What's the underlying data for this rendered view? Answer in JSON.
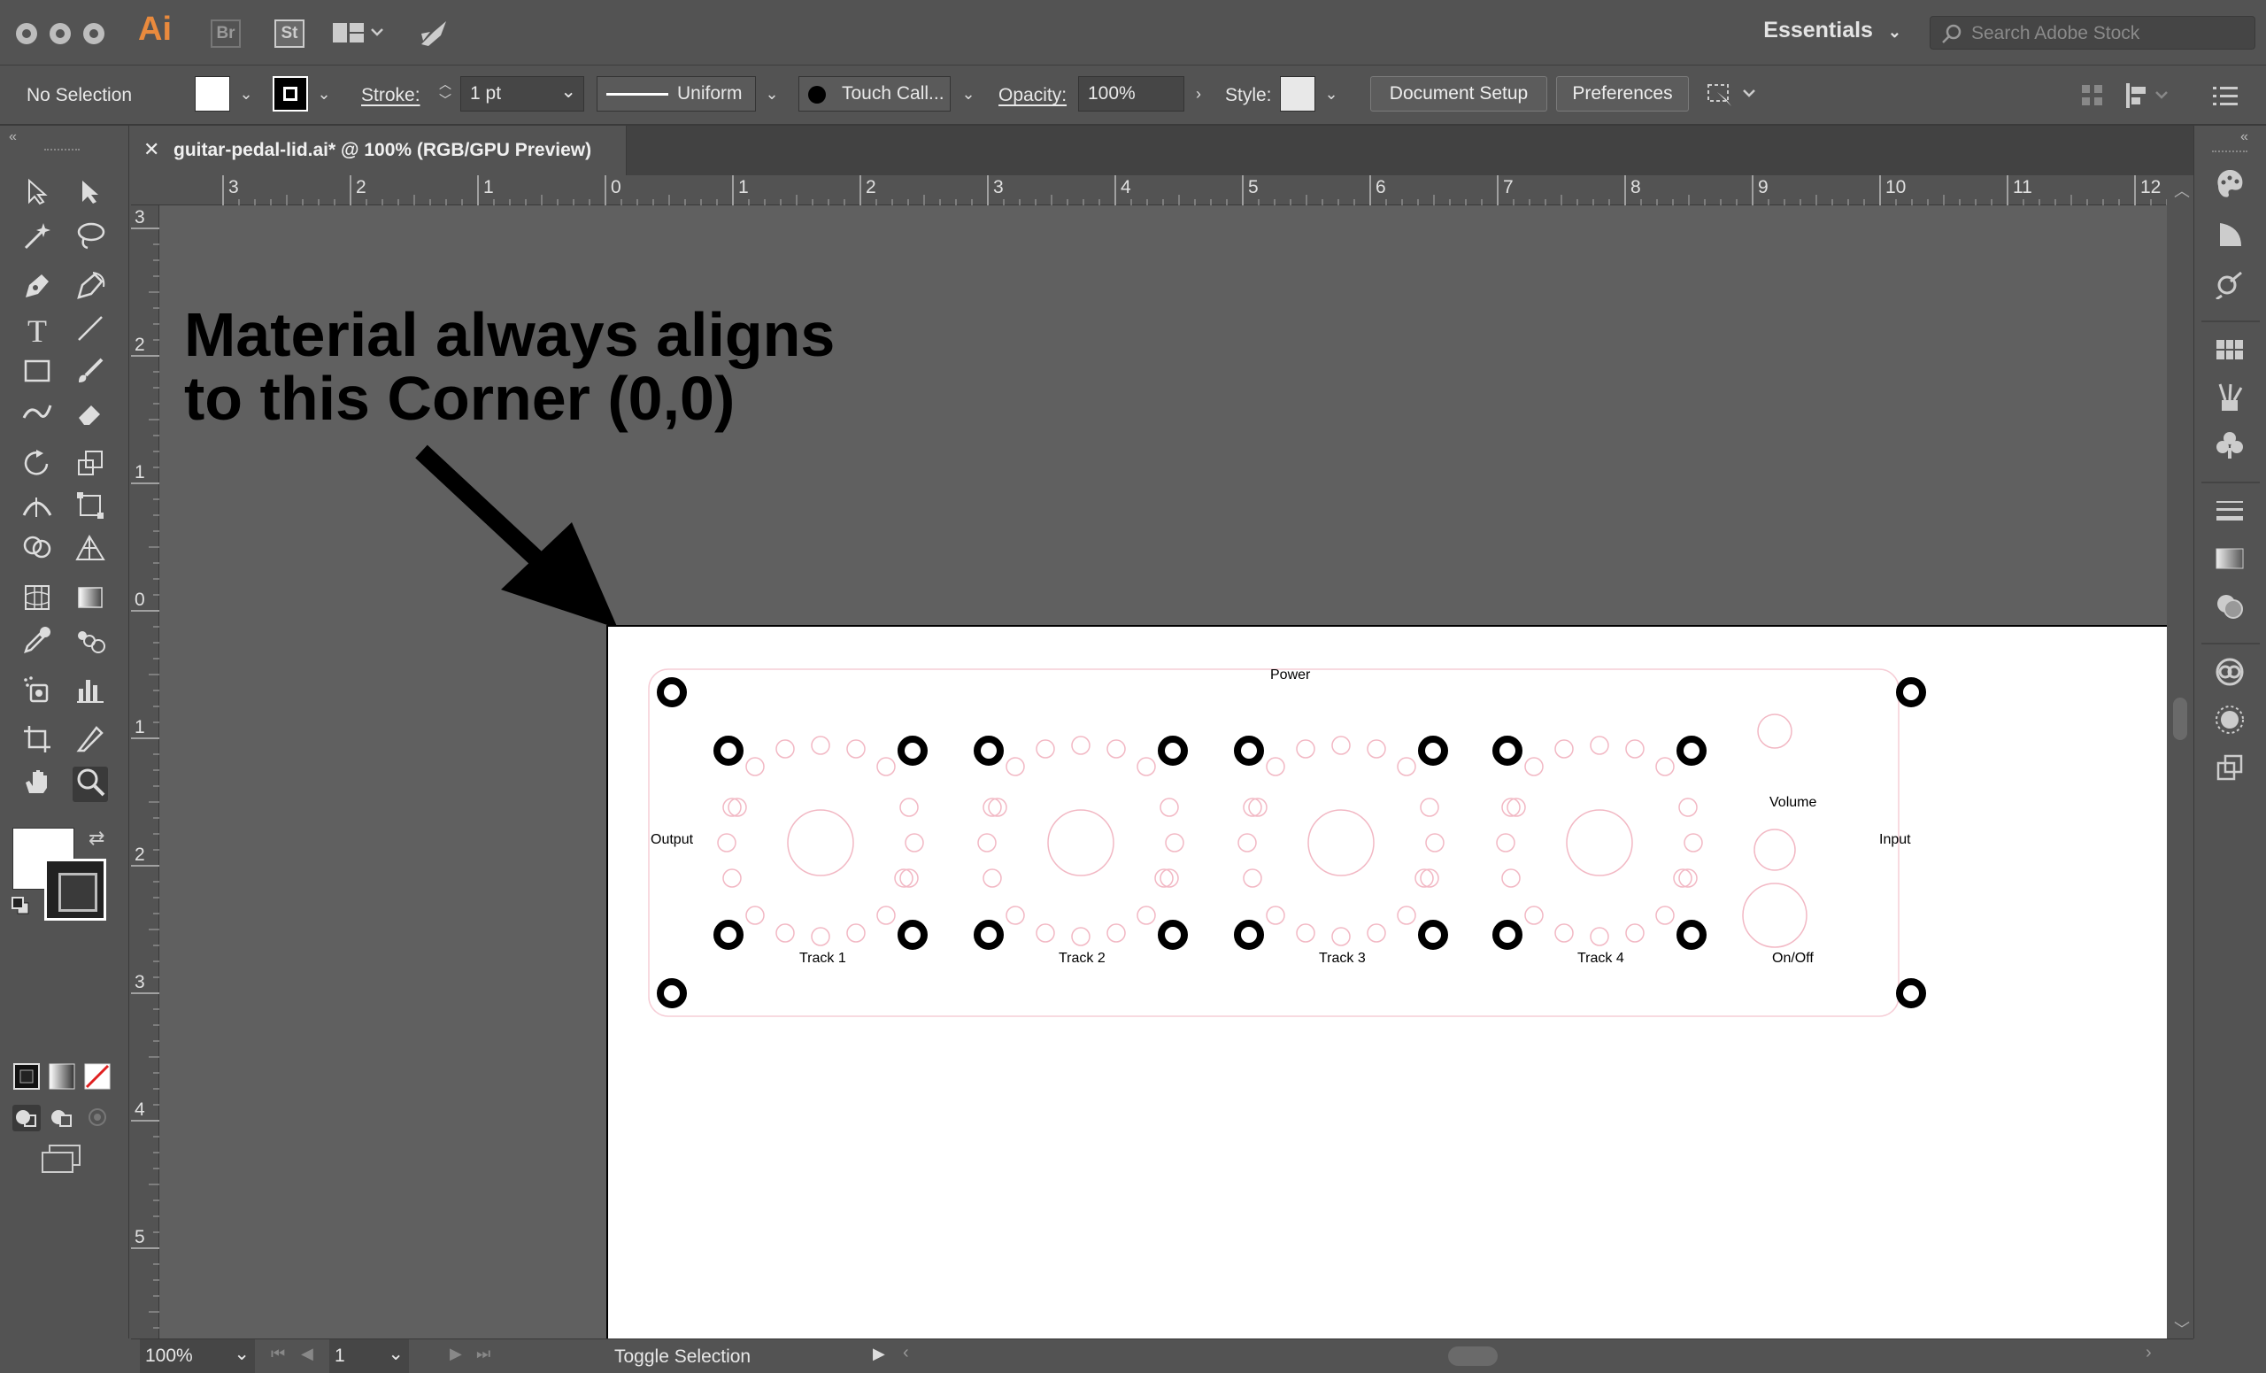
{
  "app": {
    "logo": "Ai",
    "bridge": "Br",
    "stock": "St",
    "workspace": "Essentials",
    "search_placeholder": "Search Adobe Stock"
  },
  "control_bar": {
    "selection": "No Selection",
    "stroke_label": "Stroke:",
    "stroke_weight": "1 pt",
    "profile": "Uniform",
    "brush": "Touch Call...",
    "opacity_label": "Opacity:",
    "opacity_value": "100%",
    "style_label": "Style:",
    "document_setup": "Document Setup",
    "preferences": "Preferences"
  },
  "document": {
    "tab_title": "guitar-pedal-lid.ai* @ 100% (RGB/GPU Preview)",
    "annotation": "Material always aligns\nto this Corner (0,0)"
  },
  "rulers": {
    "horizontal": [
      "3",
      "2",
      "1",
      "0",
      "1",
      "2",
      "3",
      "4",
      "5",
      "6",
      "7",
      "8",
      "9",
      "10",
      "11",
      "12"
    ],
    "vertical": [
      "3",
      "2",
      "1",
      "0",
      "1",
      "2",
      "3",
      "4",
      "5"
    ]
  },
  "artwork": {
    "power": "Power",
    "output": "Output",
    "input": "Input",
    "volume": "Volume",
    "onoff": "On/Off",
    "tracks": [
      "Track 1",
      "Track 2",
      "Track 3",
      "Track 4"
    ]
  },
  "status": {
    "zoom": "100%",
    "page": "1",
    "status_text": "Toggle Selection"
  },
  "colors": {
    "ui_bg": "#535353",
    "accent_ai": "#e98a3d",
    "guide_pink": "#f2b8c4"
  }
}
